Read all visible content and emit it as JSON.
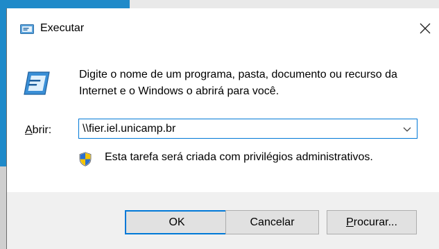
{
  "window": {
    "title": "Executar",
    "close_glyph": "✕"
  },
  "body": {
    "description": "Digite o nome de um programa, pasta, documento ou recurso da Internet e o Windows o abrirá para você.",
    "open_label_access": "A",
    "open_label_rest": "brir:",
    "command_value": "\\\\fier.iel.unicamp.br",
    "admin_note": "Esta tarefa será criada com privilégios administrativos."
  },
  "buttons": {
    "ok": "OK",
    "cancel": "Cancelar",
    "browse_access": "P",
    "browse_rest": "rocurar..."
  },
  "icons": {
    "title": "run-icon",
    "main": "run-icon",
    "dropdown": "chevron-down-icon",
    "shield": "uac-shield-icon"
  },
  "colors": {
    "accent": "#0078d7",
    "footer_bg": "#f0f0f0",
    "button_bg": "#e1e1e1"
  }
}
